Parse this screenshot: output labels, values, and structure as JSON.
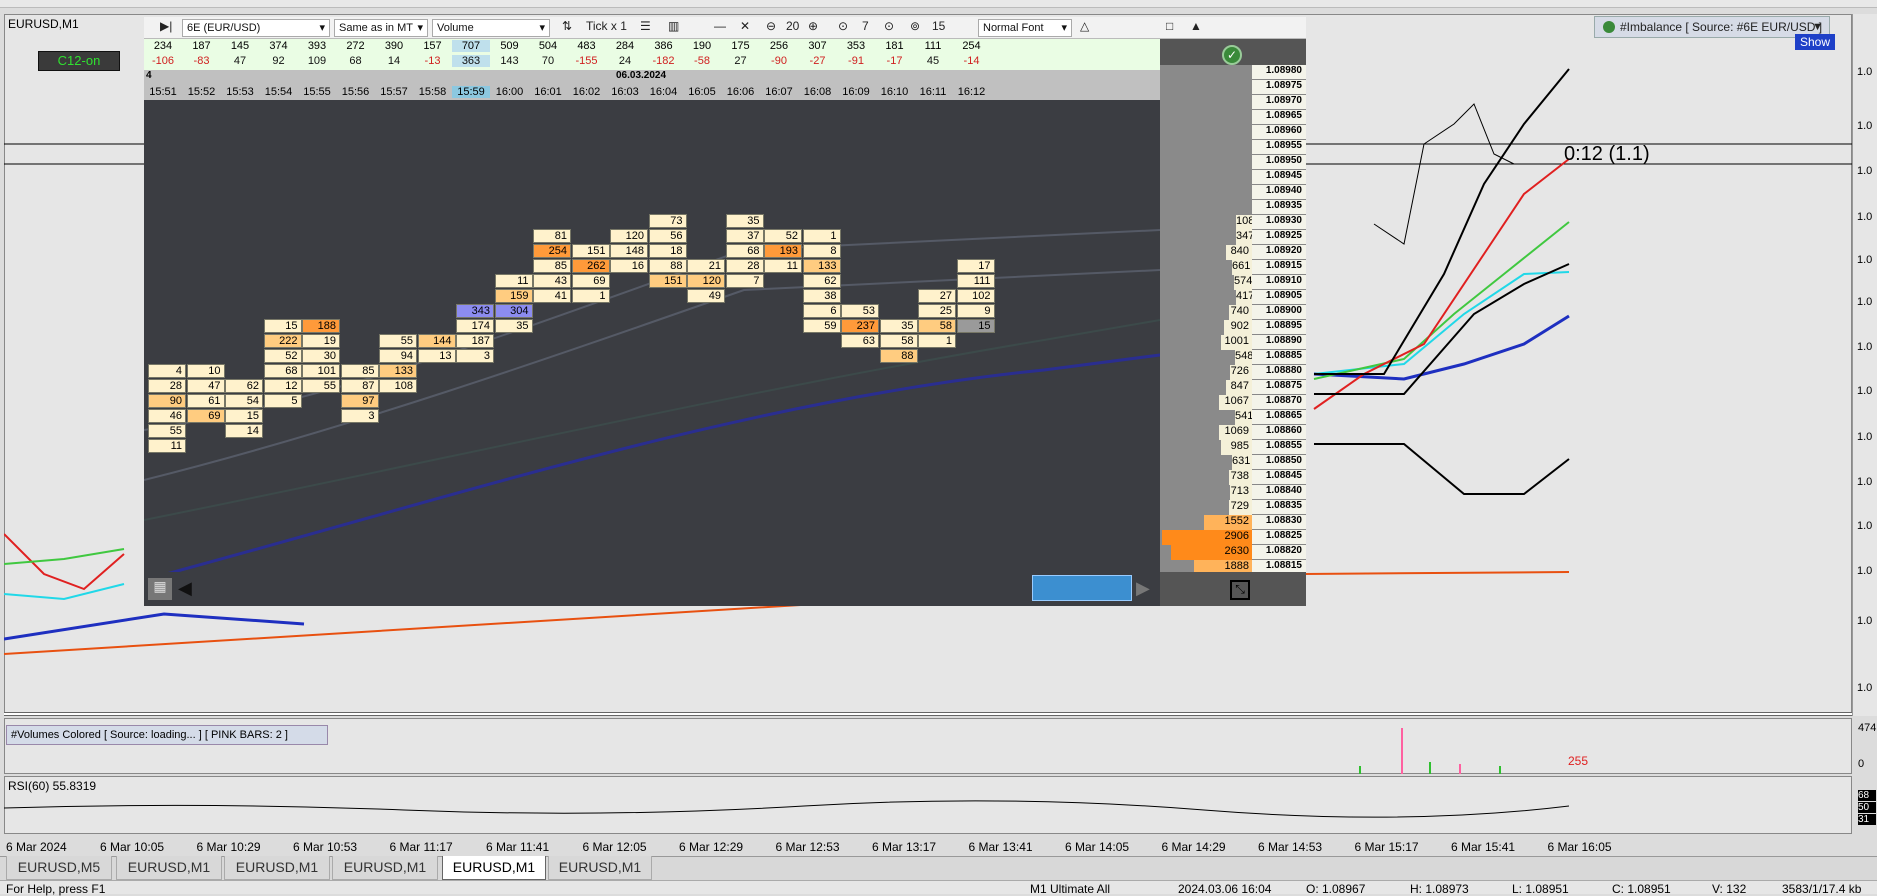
{
  "window": {
    "symbol_label": "EURUSD,M1",
    "indicator_label": "C12-on"
  },
  "imbalance": {
    "label": "#Imbalance [ Source: #6E EUR/USD ]",
    "show_button": "Show"
  },
  "chart": {
    "annotation": "0:12 (1.1)",
    "price_tick_label": "1.0",
    "colors": {
      "bg": "#e6e6e6",
      "candle_green": "#2aa02a"
    }
  },
  "toolbar": {
    "instrument": "6E (EUR/USD)",
    "scale": "Same as in MT",
    "mode": "Volume",
    "tick": "Tick x 1",
    "zoom_value": "20",
    "cluster_value": "7",
    "level_value": "15",
    "font": "Normal Font"
  },
  "orderflow": {
    "volumes": [
      "234",
      "187",
      "145",
      "374",
      "393",
      "272",
      "390",
      "157",
      "707",
      "509",
      "504",
      "483",
      "284",
      "386",
      "190",
      "175",
      "256",
      "307",
      "353",
      "181",
      "111",
      "254"
    ],
    "deltas": [
      "-106",
      "-83",
      "47",
      "92",
      "109",
      "68",
      "14",
      "-13",
      "363",
      "143",
      "70",
      "-155",
      "24",
      "-182",
      "-58",
      "27",
      "-90",
      "-27",
      "-91",
      "-17",
      "45",
      "-14"
    ],
    "date": "06.03.2024",
    "first_time": "4",
    "times": [
      "15:51",
      "15:52",
      "15:53",
      "15:54",
      "15:55",
      "15:56",
      "15:57",
      "15:58",
      "15:59",
      "16:00",
      "16:01",
      "16:02",
      "16:03",
      "16:04",
      "16:05",
      "16:06",
      "16:07",
      "16:08",
      "16:09",
      "16:10",
      "16:11",
      "16:12"
    ],
    "prices": [
      "1.08980",
      "1.08975",
      "1.08970",
      "1.08965",
      "1.08960",
      "1.08955",
      "1.08950",
      "1.08945",
      "1.08940",
      "1.08935",
      "1.08930",
      "1.08925",
      "1.08920",
      "1.08915",
      "1.08910",
      "1.08905",
      "1.08900",
      "1.08895",
      "1.08890",
      "1.08885",
      "1.08880",
      "1.08875",
      "1.08870",
      "1.08865",
      "1.08860",
      "1.08855",
      "1.08850",
      "1.08845",
      "1.08840",
      "1.08835",
      "1.08830",
      "1.08825",
      "1.08820",
      "1.08815"
    ],
    "profile": [
      {
        "row": 10,
        "v": "108"
      },
      {
        "row": 11,
        "v": "347"
      },
      {
        "row": 12,
        "v": "840"
      },
      {
        "row": 13,
        "v": "661"
      },
      {
        "row": 14,
        "v": "574"
      },
      {
        "row": 15,
        "v": "417"
      },
      {
        "row": 16,
        "v": "740"
      },
      {
        "row": 17,
        "v": "902"
      },
      {
        "row": 18,
        "v": "1001"
      },
      {
        "row": 19,
        "v": "548"
      },
      {
        "row": 20,
        "v": "726"
      },
      {
        "row": 21,
        "v": "847"
      },
      {
        "row": 22,
        "v": "1067"
      },
      {
        "row": 23,
        "v": "541"
      },
      {
        "row": 24,
        "v": "1069"
      },
      {
        "row": 25,
        "v": "985"
      },
      {
        "row": 26,
        "v": "631"
      },
      {
        "row": 27,
        "v": "738"
      },
      {
        "row": 28,
        "v": "713"
      },
      {
        "row": 29,
        "v": "729"
      },
      {
        "row": 30,
        "v": "1552"
      },
      {
        "row": 31,
        "v": "2906"
      },
      {
        "row": 32,
        "v": "2630"
      },
      {
        "row": 33,
        "v": "1888"
      }
    ]
  },
  "volumes_pane": {
    "label": "#Volumes Colored [ Source: loading... ]  [ PINK BARS: 2 ]",
    "scale_top": "474",
    "scale_bottom": "0",
    "last_value": "255"
  },
  "rsi_pane": {
    "label": "RSI(60) 55.8319",
    "levels": [
      "68",
      "50",
      "31"
    ]
  },
  "x_axis": [
    "6 Mar 2024",
    "6 Mar 10:05",
    "6 Mar 10:29",
    "6 Mar 10:53",
    "6 Mar 11:17",
    "6 Mar 11:41",
    "6 Mar 12:05",
    "6 Mar 12:29",
    "6 Mar 12:53",
    "6 Mar 13:17",
    "6 Mar 13:41",
    "6 Mar 14:05",
    "6 Mar 14:29",
    "6 Mar 14:53",
    "6 Mar 15:17",
    "6 Mar 15:41",
    "6 Mar 16:05"
  ],
  "tabs": [
    "EURUSD,M5",
    "EURUSD,M1",
    "EURUSD,M1",
    "EURUSD,M1",
    "EURUSD,M1",
    "EURUSD,M1"
  ],
  "active_tab": 4,
  "status": {
    "left": "For Help, press F1",
    "profile": "M1 Ultimate All",
    "datetime": "2024.03.06 16:04",
    "open": "O: 1.08967",
    "high": "H: 1.08973",
    "low": "L: 1.08951",
    "close": "C: 1.08951",
    "volume": "V: 132",
    "mem": "3583/1/17.4 kb"
  }
}
